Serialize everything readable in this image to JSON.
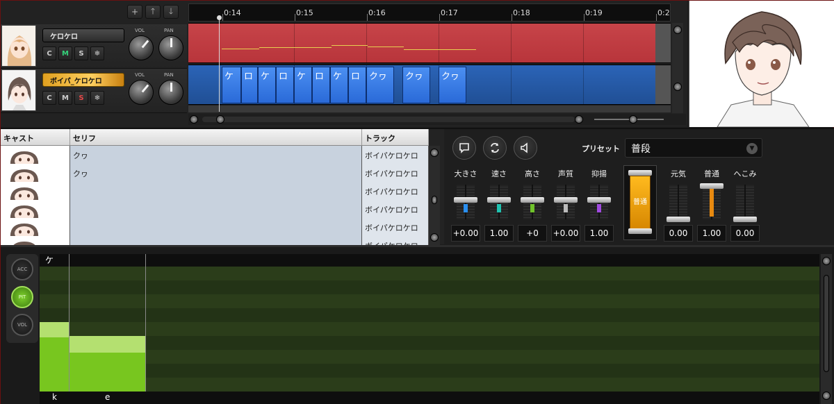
{
  "track_toolbar": {
    "add": "+",
    "up": "🡑",
    "down": "🡓"
  },
  "tracks": [
    {
      "name": "ケロケロ",
      "c": "C",
      "m": "M",
      "s": "S",
      "snow": "❄",
      "vol_label": "VOL",
      "pan_label": "PAN"
    },
    {
      "name": "ボイパ_ケロケロ",
      "c": "C",
      "m": "M",
      "s": "S",
      "snow": "❄",
      "vol_label": "VOL",
      "pan_label": "PAN"
    }
  ],
  "timeline": {
    "ticks": [
      "0:14",
      "0:15",
      "0:16",
      "0:17",
      "0:18",
      "0:19",
      "0:2"
    ]
  },
  "notes": [
    "ケ",
    "ロ",
    "ケ",
    "ロ",
    "ケ",
    "ロ",
    "ケ",
    "ロ",
    "クヮ",
    "クヮ",
    "クヮ"
  ],
  "table": {
    "headers": {
      "cast": "キャスト",
      "serif": "セリフ",
      "track": "トラック"
    },
    "rows": [
      {
        "serif": "クヮ",
        "track": "ボイパケロケロ"
      },
      {
        "serif": "クヮ",
        "track": "ボイパケロケロ"
      },
      {
        "serif": "",
        "track": "ボイパケロケロ"
      },
      {
        "serif": "",
        "track": "ボイパケロケロ"
      },
      {
        "serif": "",
        "track": "ボイパケロケロ"
      },
      {
        "serif": "",
        "track": "ボイパケロケロ"
      }
    ]
  },
  "controls": {
    "preset_label": "プリセット",
    "preset_value": "普段",
    "params": [
      {
        "label": "大きさ",
        "value": "+0.00",
        "color": "#2a8ff0"
      },
      {
        "label": "速さ",
        "value": "1.00",
        "color": "#1fc2b0"
      },
      {
        "label": "高さ",
        "value": "+0",
        "color": "#6fc22a"
      },
      {
        "label": "声質",
        "value": "+0.00",
        "color": "#bbbbbb"
      },
      {
        "label": "抑揚",
        "value": "1.00",
        "color": "#a04ae0"
      }
    ],
    "emotion_main": "普通",
    "emotions": [
      {
        "label": "元気",
        "value": "0.00"
      },
      {
        "label": "普通",
        "value": "1.00"
      },
      {
        "label": "へこみ",
        "value": "0.00"
      }
    ]
  },
  "bottom": {
    "buttons": {
      "acc": "ACC",
      "pit": "PIT",
      "vol": "VOL"
    },
    "phoneme_top": "ケ",
    "phonemes": [
      "k",
      "e"
    ]
  }
}
